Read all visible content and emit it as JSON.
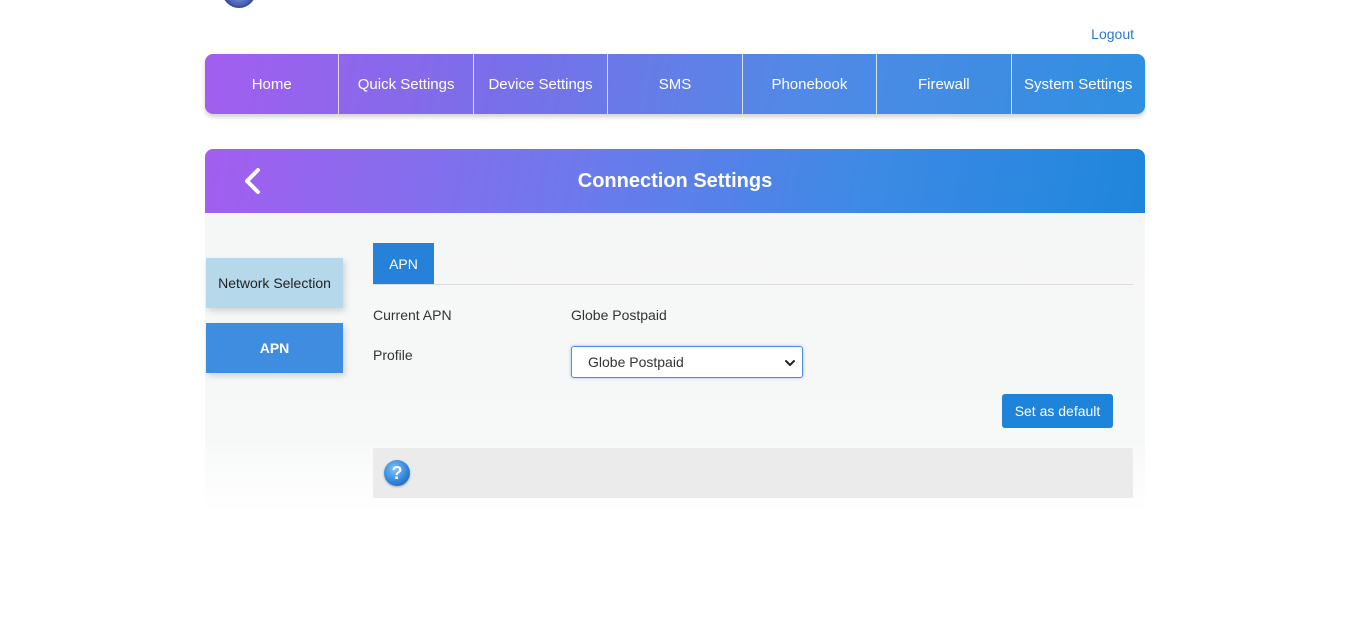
{
  "header": {
    "logout_label": "Logout"
  },
  "nav": {
    "items": [
      {
        "label": "Home"
      },
      {
        "label": "Quick Settings"
      },
      {
        "label": "Device Settings"
      },
      {
        "label": "SMS"
      },
      {
        "label": "Phonebook"
      },
      {
        "label": "Firewall"
      },
      {
        "label": "System Settings"
      }
    ]
  },
  "panel": {
    "title": "Connection Settings",
    "sidebar": {
      "items": [
        {
          "label": "Network Selection"
        },
        {
          "label": "APN"
        }
      ]
    },
    "tab_label": "APN",
    "current_apn_label": "Current APN",
    "current_apn_value": "Globe Postpaid",
    "profile_label": "Profile",
    "profile_selected": "Globe Postpaid",
    "set_default_label": "Set as default",
    "help_icon_text": "?"
  },
  "colors": {
    "accent": "#1e84da",
    "gradient_start": "#a35ef0",
    "gradient_end": "#2f8fe0",
    "sidebar_inactive": "#b5d8ea"
  }
}
